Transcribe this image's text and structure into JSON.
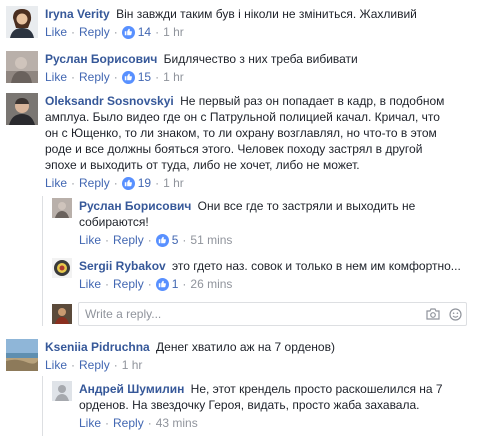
{
  "comments": [
    {
      "author": "Iryna Verity",
      "text": "Він завжди таким був і ніколи не зміниться. Жахливий",
      "like_label": "Like",
      "reply_label": "Reply",
      "likes": "14",
      "time": "1 hr"
    },
    {
      "author": "Руслан Борисович",
      "text": "Бидлячество з них треба вибивати",
      "like_label": "Like",
      "reply_label": "Reply",
      "likes": "15",
      "time": "1 hr"
    },
    {
      "author": "Oleksandr Sosnovskyi",
      "text": "Не первый раз он попадает в кадр, в подобном амплуа. Было видео где он с Патрульной полицией качал. Кричал, что он с Ющенко, то ли знаком, то ли охрану возглавлял, но что-то в этом роде и все должны бояться этого. Человек походу застрял в другой эпохе и выходить от туда, либо не хочет, либо не может.",
      "like_label": "Like",
      "reply_label": "Reply",
      "likes": "19",
      "time": "1 hr"
    }
  ],
  "replies": [
    {
      "author": "Руслан Борисович",
      "text": "Они все где то застряли и выходить не собираются!",
      "like_label": "Like",
      "reply_label": "Reply",
      "likes": "5",
      "time": "51 mins"
    },
    {
      "author": "Sergii Rybakov",
      "text": "это гдето наз. совок и только в нем им комфортно...",
      "like_label": "Like",
      "reply_label": "Reply",
      "likes": "1",
      "time": "26 mins"
    }
  ],
  "write_reply": {
    "placeholder": "Write a reply..."
  },
  "comment4": {
    "author": "Kseniia Pidruchna",
    "text": "Денег хватило аж на 7 орденов)",
    "like_label": "Like",
    "reply_label": "Reply",
    "time": "1 hr"
  },
  "reply3": {
    "author": "Андрей Шумилин",
    "text": "Не, этот крендель просто раскошелился на 7 орденов. На звездочку Героя, видать, просто жаба захавала.",
    "like_label": "Like",
    "reply_label": "Reply",
    "time": "43 mins"
  },
  "icons": {
    "like": "thumbs-up-icon",
    "camera": "camera-icon",
    "emoji": "emoji-icon"
  },
  "colors": {
    "author_link": "#365899",
    "action_link": "#4267b2",
    "meta_gray": "#90949c",
    "like_badge": "#5890ff"
  }
}
